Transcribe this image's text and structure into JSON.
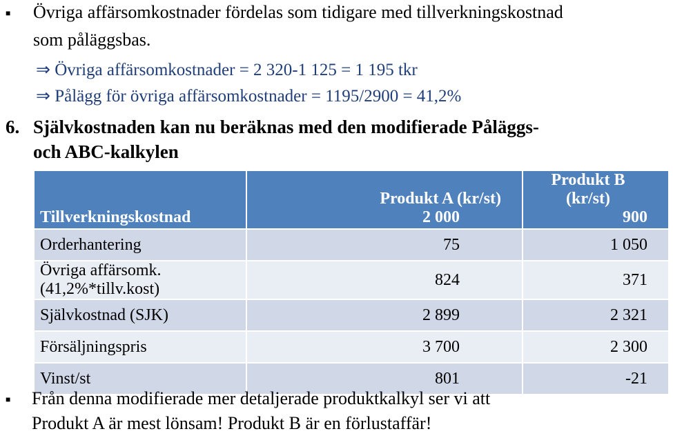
{
  "bullet1": {
    "text1": "Övriga affärsomkostnader fördelas som tidigare med  tillverkningskostnad",
    "text2": "som påläggsbas.",
    "arrow1": "⇒ Övriga affärsomkostnader = 2 320-1 125 = 1 195 tkr",
    "arrow2": "⇒ Pålägg för övriga affärsomkostnader = 1195/2900 = 41,2%"
  },
  "heading": {
    "number": "6.",
    "line1": "Självkostnaden kan nu beräknas med den modifierade Påläggs-",
    "line2": "och ABC-kalkylen"
  },
  "table": {
    "header": {
      "col_a": "Produkt A (kr/st)",
      "col_b": "Produkt B (kr/st)",
      "row_label": "Tillverkningskostnad",
      "a": "2 000",
      "b": "900"
    },
    "rows": [
      {
        "label": "Orderhantering",
        "a": "75",
        "b": "1 050"
      },
      {
        "label": "Övriga affärsomk. (41,2%*tillv.kost)",
        "a": "824",
        "b": "371"
      },
      {
        "label": "Självkostnad (SJK)",
        "a": "2 899",
        "b": "2 321"
      },
      {
        "label": "Försäljningspris",
        "a": "3 700",
        "b": "2 300"
      },
      {
        "label": "Vinst/st",
        "a": "801",
        "b": "-21"
      }
    ]
  },
  "bullet2": {
    "line1": "Från denna modifierade mer detaljerade produktkalkyl ser vi att",
    "line2": "Produkt A är mest lönsam! Produkt B är en förlustaffär!"
  },
  "bullet_glyph": "■"
}
